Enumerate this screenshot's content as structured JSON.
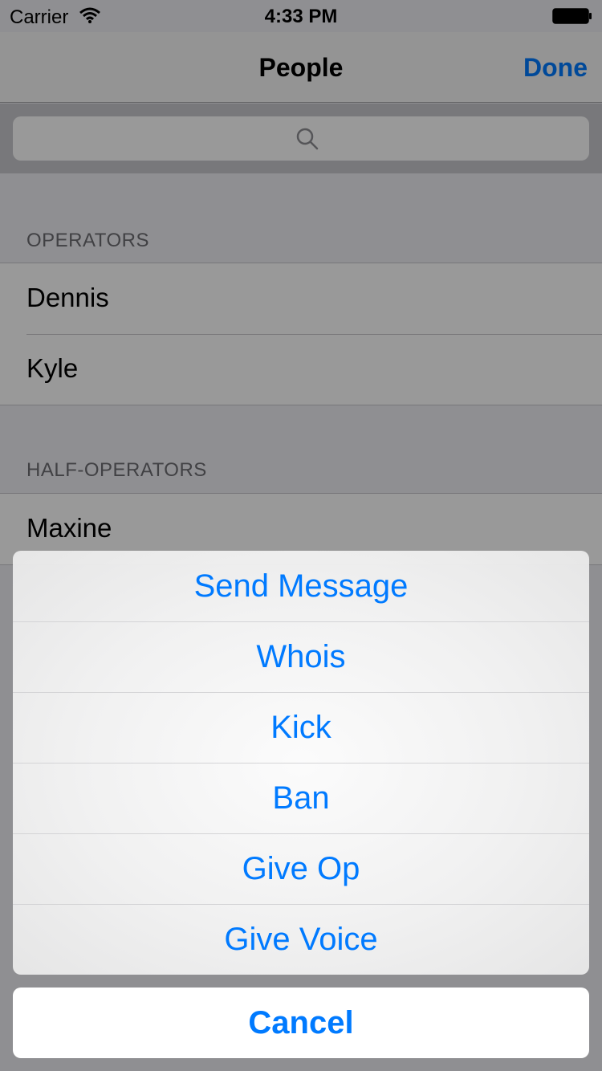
{
  "status_bar": {
    "carrier": "Carrier",
    "time": "4:33 PM"
  },
  "nav": {
    "title": "People",
    "done_label": "Done"
  },
  "search": {
    "placeholder": ""
  },
  "sections": [
    {
      "header": "OPERATORS",
      "rows": [
        "Dennis",
        "Kyle"
      ]
    },
    {
      "header": "HALF-OPERATORS",
      "rows": [
        "Maxine"
      ]
    }
  ],
  "action_sheet": {
    "buttons": [
      "Send Message",
      "Whois",
      "Kick",
      "Ban",
      "Give Op",
      "Give Voice"
    ],
    "cancel_label": "Cancel"
  },
  "colors": {
    "accent": "#007aff",
    "page_bg": "#efeff4",
    "nav_bg": "#f7f7f7"
  }
}
